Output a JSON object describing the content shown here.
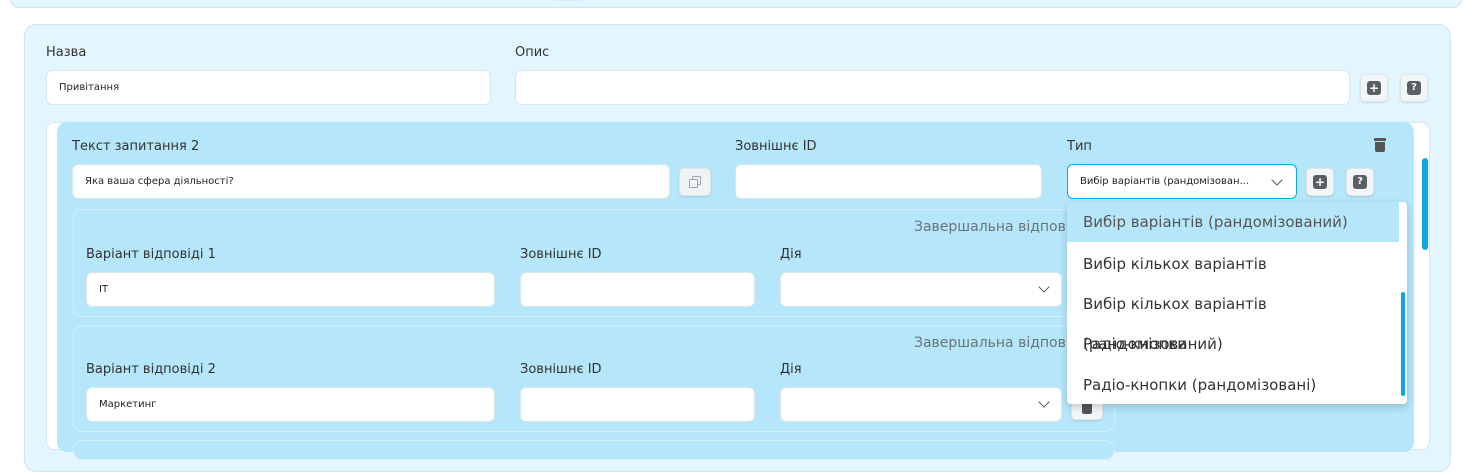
{
  "form": {
    "name_label": "Назва",
    "name_value": "Привітання",
    "description_label": "Опис",
    "description_value": ""
  },
  "question": {
    "text_label": "Текст запитання 2",
    "text_value": "Яка ваша сфера діяльності?",
    "external_id_label": "Зовнішнє ID",
    "external_id_value": "",
    "type_label": "Тип",
    "type_value": "Вибір варіантів (рандомізован..."
  },
  "answers": [
    {
      "final_label": "Завершальна відповід",
      "label": "Варіант відповіді 1",
      "value": "IT",
      "external_id_label": "Зовнішнє ID",
      "external_id_value": "",
      "action_label": "Дія",
      "action_value": ""
    },
    {
      "final_label": "Завершальна відповід",
      "label": "Варіант відповіді 2",
      "value": "Маркетинг",
      "external_id_label": "Зовнішнє ID",
      "external_id_value": "",
      "action_label": "Дія",
      "action_value": ""
    }
  ],
  "type_dropdown": {
    "options": [
      "Вибір варіантів (рандомізований)",
      "Вибір кількох варіантів",
      "Вибір кількох варіантів (рандомізований)",
      "Радіо-кнопки",
      "Радіо-кнопки (рандомізовані)"
    ],
    "selected_index": 0
  },
  "icons": {
    "plus": "+",
    "help": "?"
  },
  "colors": {
    "accent": "#0aa7e8",
    "panel_bg": "#e3f5fd",
    "card_bg": "#b5e6f9"
  }
}
